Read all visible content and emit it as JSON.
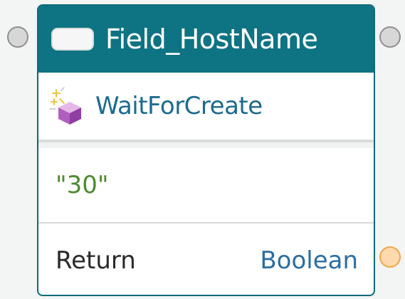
{
  "node": {
    "title": "Field_HostName",
    "title_icon": "field-pill-icon",
    "method": {
      "label": "WaitForCreate",
      "icon": "method-cube-sparkle-icon"
    },
    "parameter": {
      "value": "\"30\""
    },
    "return_row": {
      "label": "Return",
      "type": "Boolean"
    }
  },
  "colors": {
    "header_bg": "#0e7383",
    "border": "#0d6a7a",
    "method_text": "#1c6b8d",
    "param_text": "#4d8a2f",
    "return_type_text": "#2b6ea3",
    "return_port": "#f0a64a",
    "exec_port": "#8f8f8f"
  }
}
